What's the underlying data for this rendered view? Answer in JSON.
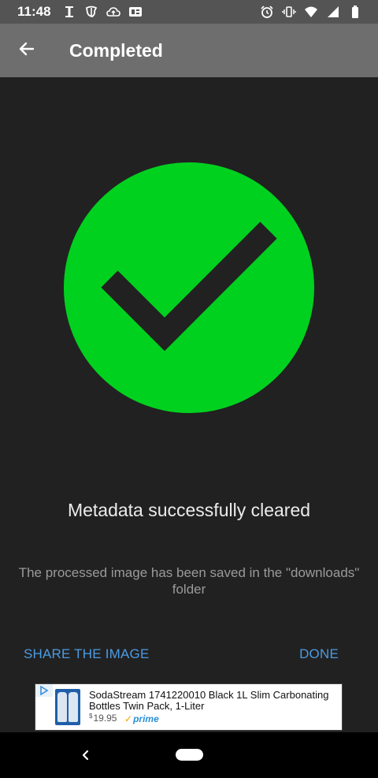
{
  "status_bar": {
    "time": "11:48",
    "left_icons": [
      "notification-i-icon",
      "news-icon",
      "cloud-upload-icon",
      "ge-badge-icon"
    ],
    "right_icons": [
      "alarm-icon",
      "vibrate-icon",
      "wifi-icon",
      "signal-icon",
      "battery-icon"
    ]
  },
  "toolbar": {
    "title": "Completed",
    "back_icon": "arrow-back-icon"
  },
  "result": {
    "icon": "check-circle-icon",
    "badge_color": "#00d11f",
    "check_color": "#212121",
    "title": "Metadata successfully cleared",
    "description": "The processed image has been saved in the \"downloads\" folder"
  },
  "actions": {
    "share_label": "SHARE THE IMAGE",
    "done_label": "DONE",
    "color": "#4b9be4"
  },
  "ad": {
    "title": "SodaStream 1741220010 Black 1L Slim Carbonating Bottles Twin Pack, 1-Liter",
    "price_currency": "$",
    "price_value": "19.95",
    "prime_label": "prime"
  },
  "nav_bar": {
    "icons": [
      "nav-back-icon",
      "home-pill-icon"
    ]
  }
}
